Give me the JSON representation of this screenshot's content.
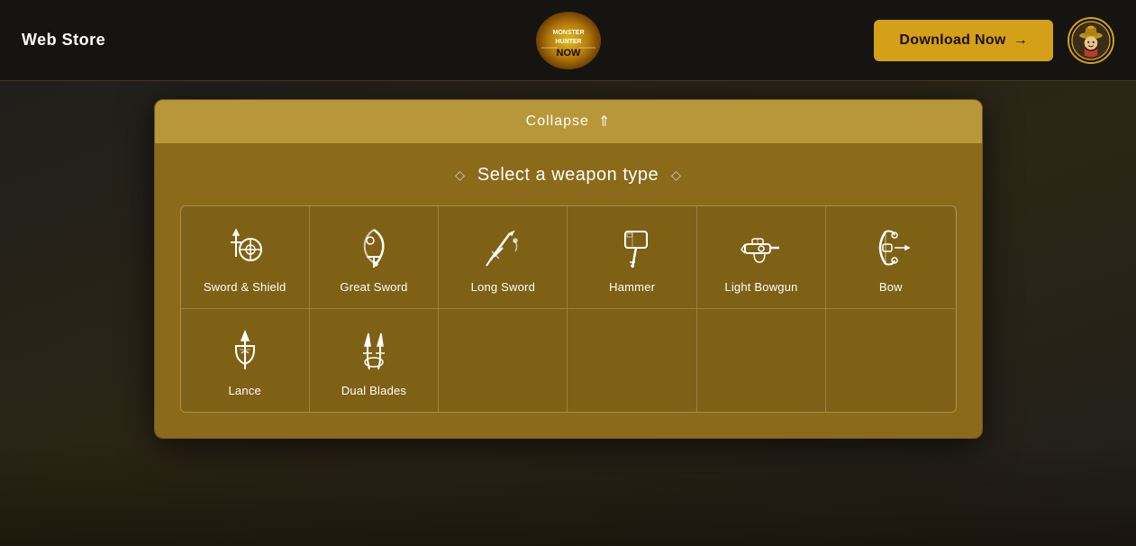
{
  "header": {
    "web_store_label": "Web Store",
    "download_btn_label": "Download Now",
    "download_btn_arrow": "→"
  },
  "modal": {
    "collapse_label": "Collapse",
    "select_title": "Select a weapon type",
    "weapons": [
      {
        "id": "sword-shield",
        "name": "Sword & Shield",
        "icon": "sword-shield"
      },
      {
        "id": "great-sword",
        "name": "Great Sword",
        "icon": "great-sword"
      },
      {
        "id": "long-sword",
        "name": "Long Sword",
        "icon": "long-sword"
      },
      {
        "id": "hammer",
        "name": "Hammer",
        "icon": "hammer"
      },
      {
        "id": "light-bowgun",
        "name": "Light Bowgun",
        "icon": "light-bowgun"
      },
      {
        "id": "bow",
        "name": "Bow",
        "icon": "bow"
      },
      {
        "id": "lance",
        "name": "Lance",
        "icon": "lance"
      },
      {
        "id": "dual-blades",
        "name": "Dual Blades",
        "icon": "dual-blades"
      },
      {
        "id": "empty1",
        "name": "",
        "icon": "empty"
      },
      {
        "id": "empty2",
        "name": "",
        "icon": "empty"
      },
      {
        "id": "empty3",
        "name": "",
        "icon": "empty"
      },
      {
        "id": "empty4",
        "name": "",
        "icon": "empty"
      }
    ]
  },
  "colors": {
    "accent": "#d4a017",
    "modal_header": "#b8973a",
    "modal_body": "#8b6a1a"
  }
}
